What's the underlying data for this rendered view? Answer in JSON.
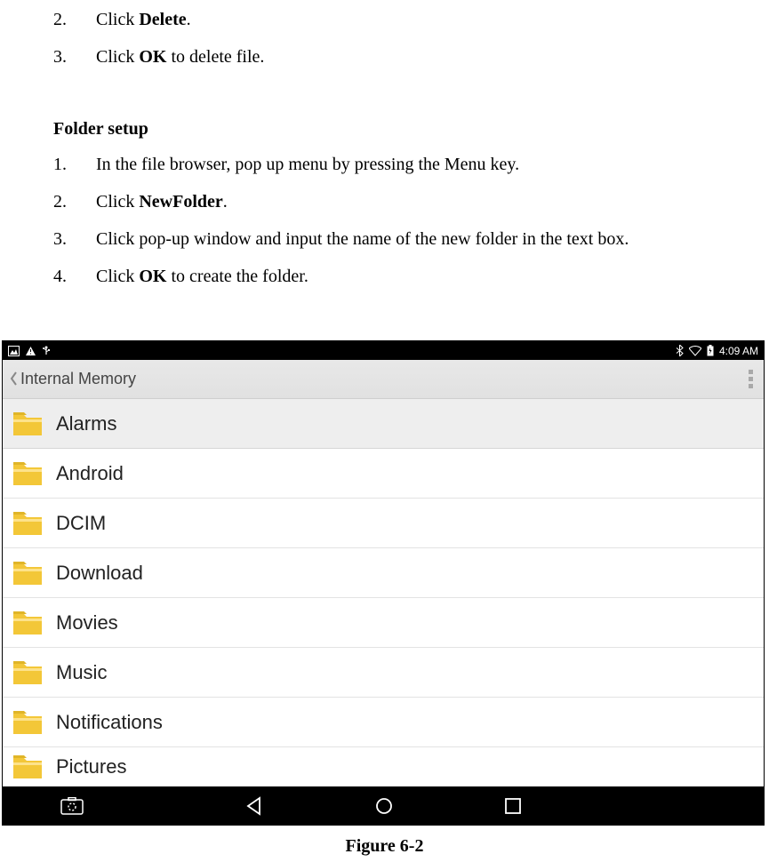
{
  "steps_top": [
    {
      "num": "2.",
      "pre": "Click ",
      "bold": "Delete",
      "post": "."
    },
    {
      "num": "3.",
      "pre": "Click ",
      "bold": "OK",
      "post": " to delete file."
    }
  ],
  "heading": "Folder setup",
  "steps_bottom": [
    {
      "num": "1.",
      "pre": "In the file browser, pop up menu by pressing the Menu key.",
      "bold": "",
      "post": ""
    },
    {
      "num": "2.",
      "pre": "Click ",
      "bold": "NewFolder",
      "post": "."
    },
    {
      "num": "3.",
      "pre": "Click pop-up window and input the name of the new folder in the text box.",
      "bold": "",
      "post": ""
    },
    {
      "num": "4.",
      "pre": "Click ",
      "bold": "OK",
      "post": " to create the folder."
    }
  ],
  "screenshot": {
    "status_time": "4:09 AM",
    "app_title": "Internal Memory",
    "folders": [
      "Alarms",
      "Android",
      "DCIM",
      "Download",
      "Movies",
      "Music",
      "Notifications",
      "Pictures"
    ]
  },
  "figure_caption": "Figure 6-2"
}
